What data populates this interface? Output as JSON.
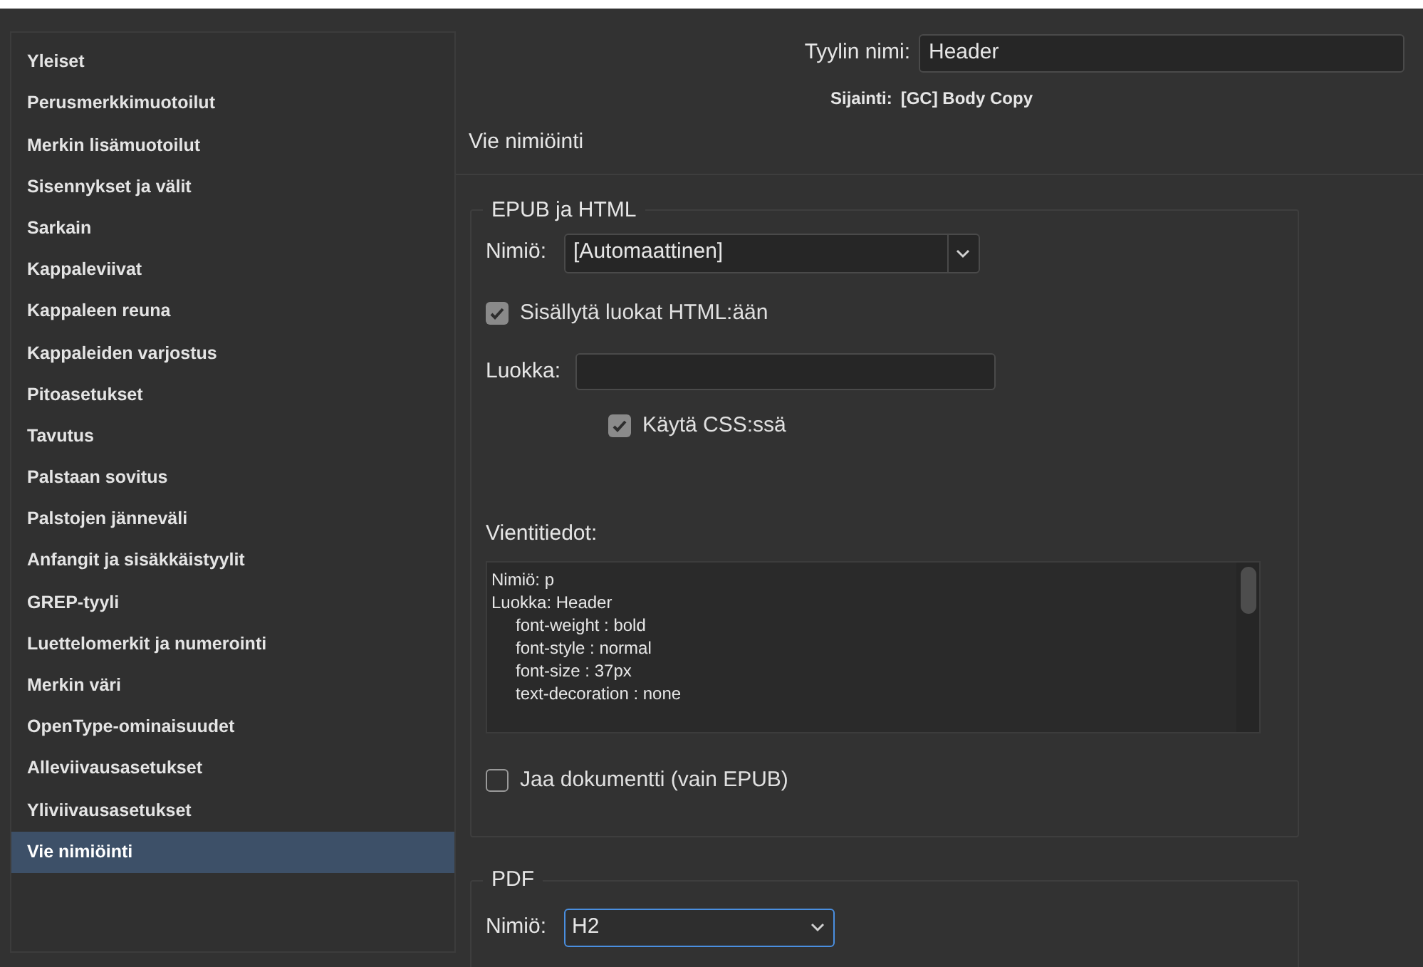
{
  "sidebar": {
    "items": [
      {
        "label": "Yleiset",
        "selected": false
      },
      {
        "label": "Perusmerkkimuotoilut",
        "selected": false
      },
      {
        "label": "Merkin lisämuotoilut",
        "selected": false
      },
      {
        "label": "Sisennykset ja välit",
        "selected": false
      },
      {
        "label": "Sarkain",
        "selected": false
      },
      {
        "label": "Kappaleviivat",
        "selected": false
      },
      {
        "label": "Kappaleen reuna",
        "selected": false
      },
      {
        "label": "Kappaleiden varjostus",
        "selected": false
      },
      {
        "label": "Pitoasetukset",
        "selected": false
      },
      {
        "label": "Tavutus",
        "selected": false
      },
      {
        "label": "Palstaan sovitus",
        "selected": false
      },
      {
        "label": "Palstojen jänneväli",
        "selected": false
      },
      {
        "label": "Anfangit ja sisäkkäistyylit",
        "selected": false
      },
      {
        "label": "GREP-tyyli",
        "selected": false
      },
      {
        "label": "Luettelomerkit ja numerointi",
        "selected": false
      },
      {
        "label": "Merkin väri",
        "selected": false
      },
      {
        "label": "OpenType-ominaisuudet",
        "selected": false
      },
      {
        "label": "Alleviivausasetukset",
        "selected": false
      },
      {
        "label": "Yliviivausasetukset",
        "selected": false
      },
      {
        "label": "Vie nimiöinti",
        "selected": true
      }
    ]
  },
  "style_name": {
    "label": "Tyylin nimi:",
    "value": "Header"
  },
  "location": {
    "label": "Sijainti:",
    "value": "[GC] Body Copy"
  },
  "section_title": "Vie nimiöinti",
  "epub": {
    "legend": "EPUB ja HTML",
    "tag": {
      "label": "Nimiö:",
      "value": "[Automaattinen]"
    },
    "include_classes": {
      "label": "Sisällytä luokat HTML:ään",
      "checked": true
    },
    "class": {
      "label": "Luokka:"
    },
    "use_css": {
      "label": "Käytä CSS:ssä",
      "checked": true
    },
    "export_details": {
      "label": "Vientitiedot:",
      "lines": [
        {
          "text": "Nimiö: p",
          "indented": false
        },
        {
          "text": "Luokka: Header",
          "indented": false
        },
        {
          "text": "font-weight : bold",
          "indented": true
        },
        {
          "text": "font-style : normal",
          "indented": true
        },
        {
          "text": "font-size : 37px",
          "indented": true
        },
        {
          "text": "text-decoration : none",
          "indented": true
        }
      ]
    },
    "split_document": {
      "label": "Jaa dokumentti (vain EPUB)",
      "checked": false
    }
  },
  "pdf": {
    "legend": "PDF",
    "tag": {
      "label": "Nimiö:",
      "value": "H2",
      "focused": true
    }
  }
}
